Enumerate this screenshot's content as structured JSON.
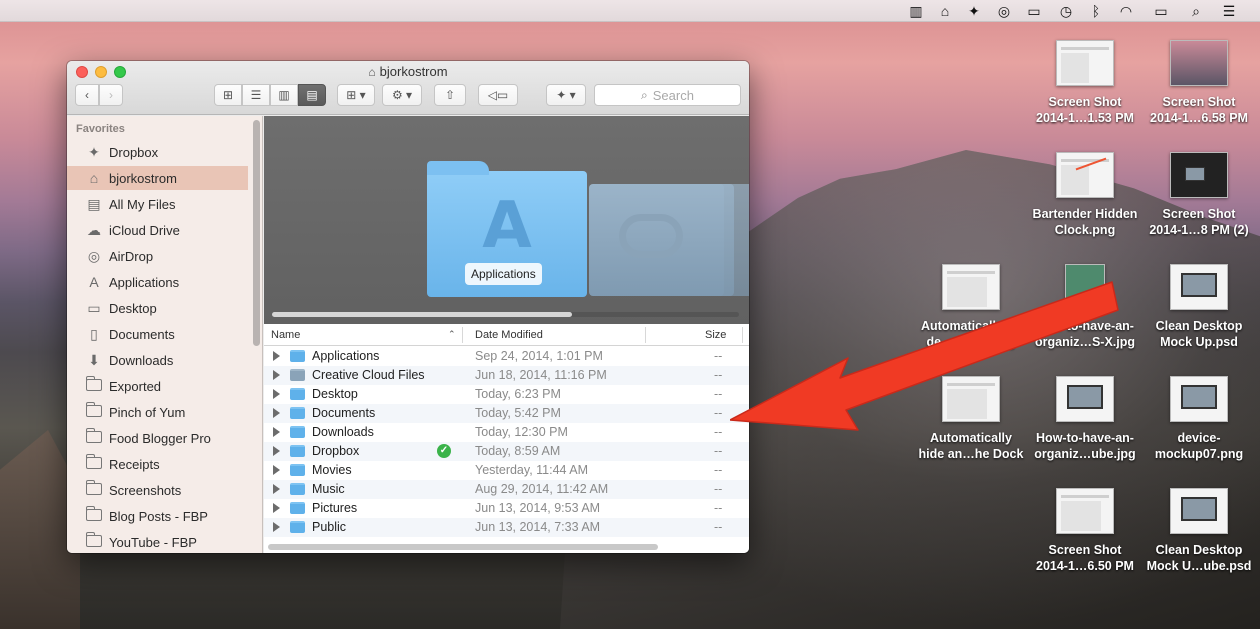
{
  "menubar": {
    "icons": [
      "battery-status-icon",
      "home-icon",
      "dropbox-icon",
      "creative-cloud-icon",
      "airplay-icon",
      "time-machine-icon",
      "bluetooth-icon",
      "wifi-icon",
      "battery-icon",
      "spotlight-icon",
      "notification-center-icon"
    ]
  },
  "window": {
    "title": "bjorkostrom",
    "search_placeholder": "Search"
  },
  "sidebar": {
    "heading": "Favorites",
    "items": [
      {
        "label": "Dropbox",
        "icon": "dropbox-icon"
      },
      {
        "label": "bjorkostrom",
        "icon": "home-icon"
      },
      {
        "label": "All My Files",
        "icon": "all-files-icon"
      },
      {
        "label": "iCloud Drive",
        "icon": "cloud-icon"
      },
      {
        "label": "AirDrop",
        "icon": "airdrop-icon"
      },
      {
        "label": "Applications",
        "icon": "applications-icon"
      },
      {
        "label": "Desktop",
        "icon": "desktop-icon"
      },
      {
        "label": "Documents",
        "icon": "documents-icon"
      },
      {
        "label": "Downloads",
        "icon": "downloads-icon"
      },
      {
        "label": "Exported",
        "icon": "folder-icon"
      },
      {
        "label": "Pinch of Yum",
        "icon": "folder-icon"
      },
      {
        "label": "Food Blogger Pro",
        "icon": "folder-icon"
      },
      {
        "label": "Receipts",
        "icon": "folder-icon"
      },
      {
        "label": "Screenshots",
        "icon": "folder-icon"
      },
      {
        "label": "Blog Posts - FBP",
        "icon": "folder-icon"
      },
      {
        "label": "YouTube - FBP",
        "icon": "folder-icon"
      }
    ]
  },
  "coverflow": {
    "selected_label": "Applications"
  },
  "list": {
    "headers": {
      "name": "Name",
      "date": "Date Modified",
      "size": "Size"
    },
    "rows": [
      {
        "name": "Applications",
        "date": "Sep 24, 2014, 1:01 PM",
        "size": "--"
      },
      {
        "name": "Creative Cloud Files",
        "date": "Jun 18, 2014, 11:16 PM",
        "size": "--"
      },
      {
        "name": "Desktop",
        "date": "Today, 6:23 PM",
        "size": "--"
      },
      {
        "name": "Documents",
        "date": "Today, 5:42 PM",
        "size": "--"
      },
      {
        "name": "Downloads",
        "date": "Today, 12:30 PM",
        "size": "--"
      },
      {
        "name": "Dropbox",
        "date": "Today, 8:59 AM",
        "size": "--"
      },
      {
        "name": "Movies",
        "date": "Yesterday, 11:44 AM",
        "size": "--"
      },
      {
        "name": "Music",
        "date": "Aug 29, 2014, 11:42 AM",
        "size": "--"
      },
      {
        "name": "Pictures",
        "date": "Jun 13, 2014, 9:53 AM",
        "size": "--"
      },
      {
        "name": "Public",
        "date": "Jun 13, 2014, 7:33 AM",
        "size": "--"
      }
    ]
  },
  "desktop": {
    "icons": [
      {
        "l1": "Screen Shot",
        "l2": "2014-1…1.53 PM"
      },
      {
        "l1": "Screen Shot",
        "l2": "2014-1…6.58 PM"
      },
      {
        "l1": "Bartender Hidden",
        "l2": "Clock.png"
      },
      {
        "l1": "Screen Shot",
        "l2": "2014-1…8 PM (2)"
      },
      {
        "l1": "Automatically_hi",
        "l2": "de_a…ock.png"
      },
      {
        "l1": "How-to-have-an-",
        "l2": "organiz…S-X.jpg"
      },
      {
        "l1": "Clean Desktop",
        "l2": "Mock Up.psd"
      },
      {
        "l1": "Automatically",
        "l2": "hide an…he Dock"
      },
      {
        "l1": "How-to-have-an-",
        "l2": "organiz…ube.jpg"
      },
      {
        "l1": "device-",
        "l2": "mockup07.png"
      },
      {
        "l1": "Screen Shot",
        "l2": "2014-1…6.50 PM"
      },
      {
        "l1": "Clean Desktop",
        "l2": "Mock U…ube.psd"
      }
    ]
  },
  "colors": {
    "selection": "#e9c5b6",
    "folder_blue": "#5fb1ea",
    "arrow_red": "#f03a24",
    "sync_green": "#3bb34a"
  }
}
